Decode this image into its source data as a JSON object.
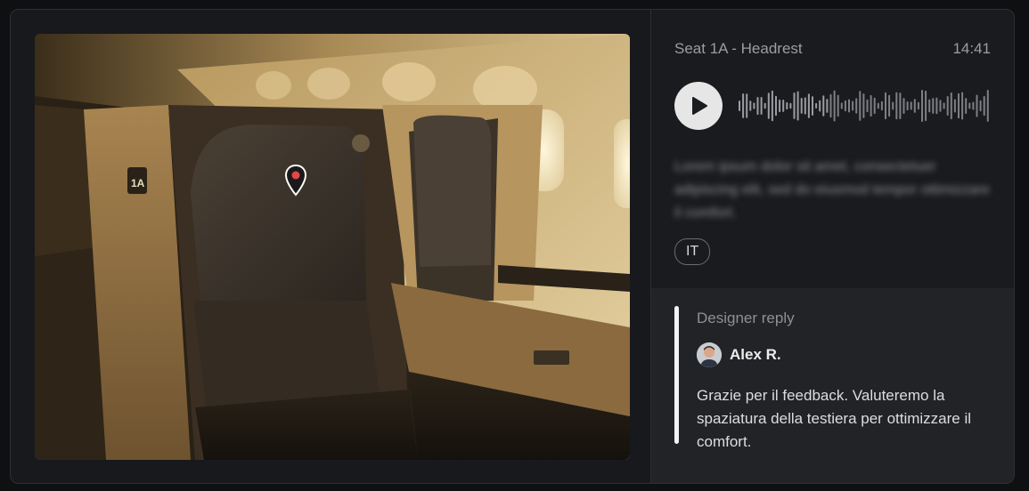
{
  "image": {
    "alt": "Airplane first class seat",
    "seat_sign": "1A"
  },
  "feedback": {
    "title": "Seat 1A - Headrest",
    "time": "14:41",
    "transcript": "Lorem ipsum dolor sit amet, consectetuer adipiscing elit, sed do eiusmod tempor ottimizzare il comfort.",
    "language": "IT"
  },
  "reply": {
    "label": "Designer reply",
    "author": "Alex R.",
    "message": "Grazie per il feedback. Valuteremo la spaziatura della testiera per ottimizzare il comfort."
  },
  "icons": {
    "pin": "map-pin-icon",
    "play": "play-icon",
    "avatar": "avatar"
  },
  "colors": {
    "background": "#0f1012",
    "card": "#18191c",
    "reply_panel": "#222326",
    "accent_bar": "#f2f2f2",
    "pin": "#e0464a"
  }
}
